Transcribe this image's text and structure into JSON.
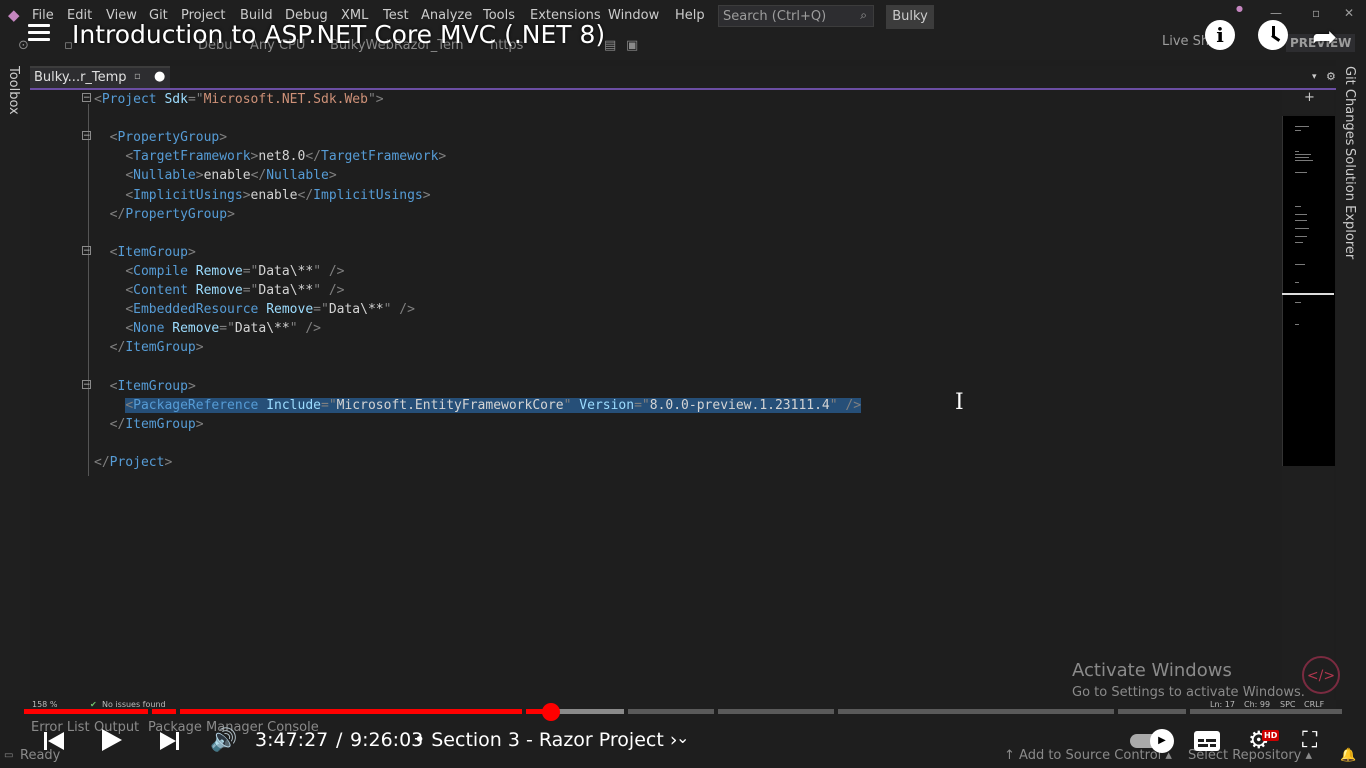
{
  "menubar": {
    "items": [
      "File",
      "Edit",
      "View",
      "Git",
      "Project",
      "Build",
      "Debug",
      "XML",
      "Test",
      "Analyze",
      "Tools",
      "Extensions",
      "Window",
      "Help"
    ],
    "search_placeholder": "Search (Ctrl+Q)",
    "solution_name": "Bulky"
  },
  "toolbar": {
    "config": "Debu",
    "platform": "Any CPU",
    "startup_project": "BulkyWebRazor_Tem",
    "launch_profile": "https",
    "live_share": "Live Share",
    "preview": "PREVIEW"
  },
  "video": {
    "title": "Introduction to ASP.NET Core MVC (.NET 8)",
    "time_current": "3:47:27",
    "time_separator": "/",
    "time_total": "9:26:03",
    "chapter": "• Section 3 - Razor Project ›",
    "progress_fraction": 0.3995,
    "buffered_fraction": 0.455,
    "hd_label": "HD"
  },
  "side_tools": {
    "left": "Toolbox",
    "right": [
      "Git Changes",
      "Solution Explorer"
    ]
  },
  "document_tab": {
    "label": "Bulky...r_Temp",
    "modified": "●"
  },
  "code": [
    {
      "fold": "⊟",
      "tokens": [
        [
          "br",
          "<"
        ],
        [
          "tag",
          "Project"
        ],
        [
          "txt",
          " "
        ],
        [
          "attr",
          "Sdk"
        ],
        [
          "br",
          "=\""
        ],
        [
          "str",
          "Microsoft.NET.Sdk.Web"
        ],
        [
          "br",
          "\">"
        ]
      ]
    },
    {
      "tokens": []
    },
    {
      "fold": "⊟",
      "tokens": [
        [
          "txt",
          "  "
        ],
        [
          "br",
          "<"
        ],
        [
          "tag",
          "PropertyGroup"
        ],
        [
          "br",
          ">"
        ]
      ]
    },
    {
      "tokens": [
        [
          "txt",
          "    "
        ],
        [
          "br",
          "<"
        ],
        [
          "tag",
          "TargetFramework"
        ],
        [
          "br",
          ">"
        ],
        [
          "txt",
          "net8.0"
        ],
        [
          "br",
          "</"
        ],
        [
          "tag",
          "TargetFramework"
        ],
        [
          "br",
          ">"
        ]
      ]
    },
    {
      "tokens": [
        [
          "txt",
          "    "
        ],
        [
          "br",
          "<"
        ],
        [
          "tag",
          "Nullable"
        ],
        [
          "br",
          ">"
        ],
        [
          "txt",
          "enable"
        ],
        [
          "br",
          "</"
        ],
        [
          "tag",
          "Nullable"
        ],
        [
          "br",
          ">"
        ]
      ]
    },
    {
      "tokens": [
        [
          "txt",
          "    "
        ],
        [
          "br",
          "<"
        ],
        [
          "tag",
          "ImplicitUsings"
        ],
        [
          "br",
          ">"
        ],
        [
          "txt",
          "enable"
        ],
        [
          "br",
          "</"
        ],
        [
          "tag",
          "ImplicitUsings"
        ],
        [
          "br",
          ">"
        ]
      ]
    },
    {
      "tokens": [
        [
          "txt",
          "  "
        ],
        [
          "br",
          "</"
        ],
        [
          "tag",
          "PropertyGroup"
        ],
        [
          "br",
          ">"
        ]
      ]
    },
    {
      "tokens": []
    },
    {
      "fold": "⊟",
      "tokens": [
        [
          "txt",
          "  "
        ],
        [
          "br",
          "<"
        ],
        [
          "tag",
          "ItemGroup"
        ],
        [
          "br",
          ">"
        ]
      ]
    },
    {
      "tokens": [
        [
          "txt",
          "    "
        ],
        [
          "br",
          "<"
        ],
        [
          "tag",
          "Compile"
        ],
        [
          "txt",
          " "
        ],
        [
          "attr",
          "Remove"
        ],
        [
          "br",
          "=\""
        ],
        [
          "txt",
          "Data\\**"
        ],
        [
          "br",
          "\" />"
        ]
      ]
    },
    {
      "tokens": [
        [
          "txt",
          "    "
        ],
        [
          "br",
          "<"
        ],
        [
          "tag",
          "Content"
        ],
        [
          "txt",
          " "
        ],
        [
          "attr",
          "Remove"
        ],
        [
          "br",
          "=\""
        ],
        [
          "txt",
          "Data\\**"
        ],
        [
          "br",
          "\" />"
        ]
      ]
    },
    {
      "tokens": [
        [
          "txt",
          "    "
        ],
        [
          "br",
          "<"
        ],
        [
          "tag",
          "EmbeddedResource"
        ],
        [
          "txt",
          " "
        ],
        [
          "attr",
          "Remove"
        ],
        [
          "br",
          "=\""
        ],
        [
          "txt",
          "Data\\**"
        ],
        [
          "br",
          "\" />"
        ]
      ]
    },
    {
      "tokens": [
        [
          "txt",
          "    "
        ],
        [
          "br",
          "<"
        ],
        [
          "tag",
          "None"
        ],
        [
          "txt",
          " "
        ],
        [
          "attr",
          "Remove"
        ],
        [
          "br",
          "=\""
        ],
        [
          "txt",
          "Data\\**"
        ],
        [
          "br",
          "\" />"
        ]
      ]
    },
    {
      "tokens": [
        [
          "txt",
          "  "
        ],
        [
          "br",
          "</"
        ],
        [
          "tag",
          "ItemGroup"
        ],
        [
          "br",
          ">"
        ]
      ]
    },
    {
      "tokens": []
    },
    {
      "fold": "⊟",
      "tokens": [
        [
          "txt",
          "  "
        ],
        [
          "br",
          "<"
        ],
        [
          "tag",
          "ItemGroup"
        ],
        [
          "br",
          ">"
        ]
      ]
    },
    {
      "selected": true,
      "tokens": [
        [
          "txt",
          "    "
        ],
        [
          "br",
          "<"
        ],
        [
          "tag",
          "PackageReference"
        ],
        [
          "txt",
          " "
        ],
        [
          "attr",
          "Include"
        ],
        [
          "br",
          "=\""
        ],
        [
          "txt",
          "Microsoft.EntityFrameworkCore"
        ],
        [
          "br",
          "\" "
        ],
        [
          "attr",
          "Version"
        ],
        [
          "br",
          "=\""
        ],
        [
          "txt",
          "8.0.0-preview.1.23111.4"
        ],
        [
          "br",
          "\" />"
        ]
      ]
    },
    {
      "tokens": [
        [
          "txt",
          "  "
        ],
        [
          "br",
          "</"
        ],
        [
          "tag",
          "ItemGroup"
        ],
        [
          "br",
          ">"
        ]
      ]
    },
    {
      "tokens": []
    },
    {
      "tokens": [
        [
          "br",
          "</"
        ],
        [
          "tag",
          "Project"
        ],
        [
          "br",
          ">"
        ]
      ]
    }
  ],
  "editor_status": {
    "zoom": "158 %",
    "issues": "No issues found",
    "line": "Ln: 17",
    "col": "Ch: 99",
    "spc": "SPC",
    "eol": "CRLF"
  },
  "watermark": {
    "title": "Activate Windows",
    "subtitle": "Go to Settings to activate Windows."
  },
  "bottom_tabs": [
    "Error List",
    "Output",
    "Package Manager Console"
  ],
  "statusbar": {
    "ready": "Ready",
    "source_control": "↑ Add to Source Control ▴",
    "repository": "Select Repository ▴"
  },
  "colors": {
    "accent": "#6b4ea3",
    "progress": "#ff0000",
    "selection": "#264f78",
    "tag": "#569cd6",
    "attr": "#9cdcfe"
  }
}
